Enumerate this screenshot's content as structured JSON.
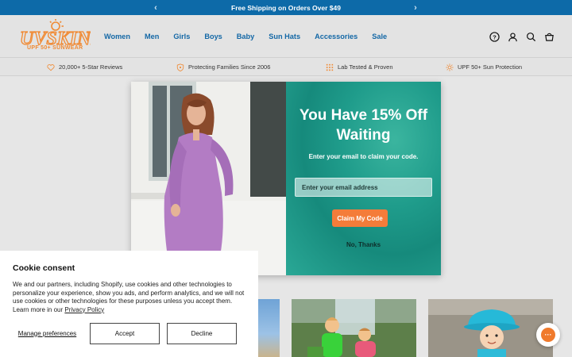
{
  "announcement": {
    "text": "Free Shipping on Orders Over $49",
    "prev_icon": "chevron-left-icon",
    "next_icon": "chevron-right-icon"
  },
  "brand": {
    "logo_text": "UVSKINZ",
    "tagline": "UPF 50+ SUNWEAR",
    "logo_color": "#f08a34"
  },
  "nav": {
    "items": [
      "Women",
      "Men",
      "Girls",
      "Boys",
      "Baby",
      "Sun Hats",
      "Accessories",
      "Sale"
    ],
    "color": "#1468a6"
  },
  "header_icons": [
    "help-icon",
    "account-icon",
    "search-icon",
    "cart-icon"
  ],
  "trust_bar": {
    "items": [
      {
        "label": "20,000+ 5-Star Reviews",
        "icon": "heart-icon"
      },
      {
        "label": "Protecting Families Since 2006",
        "icon": "shield-icon"
      },
      {
        "label": "Lab Tested & Proven",
        "icon": "lab-grid-icon"
      },
      {
        "label": "UPF 50+ Sun Protection",
        "icon": "sun-icon"
      }
    ]
  },
  "popup": {
    "headline_line1": "You Have 15% Off",
    "headline_line2": "Waiting",
    "subtext": "Enter your email to claim your code.",
    "email_placeholder": "Enter your email address",
    "claim_label": "Claim My Code",
    "dismiss_label": "No, Thanks",
    "accent": "#f47c3a",
    "panel_color": "#1f9c8b"
  },
  "cookie": {
    "title": "Cookie consent",
    "body": "We and our partners, including Shopify, use cookies and other technologies to personalize your experience, show you ads, and perform analytics, and we will not use cookies or other technologies for these purposes unless you accept them. Learn more in our ",
    "privacy_link": "Privacy Policy",
    "manage_label": "Manage preferences",
    "accept_label": "Accept",
    "decline_label": "Decline"
  },
  "chat": {
    "icon": "chat-bubble-icon",
    "glyph": "···"
  }
}
